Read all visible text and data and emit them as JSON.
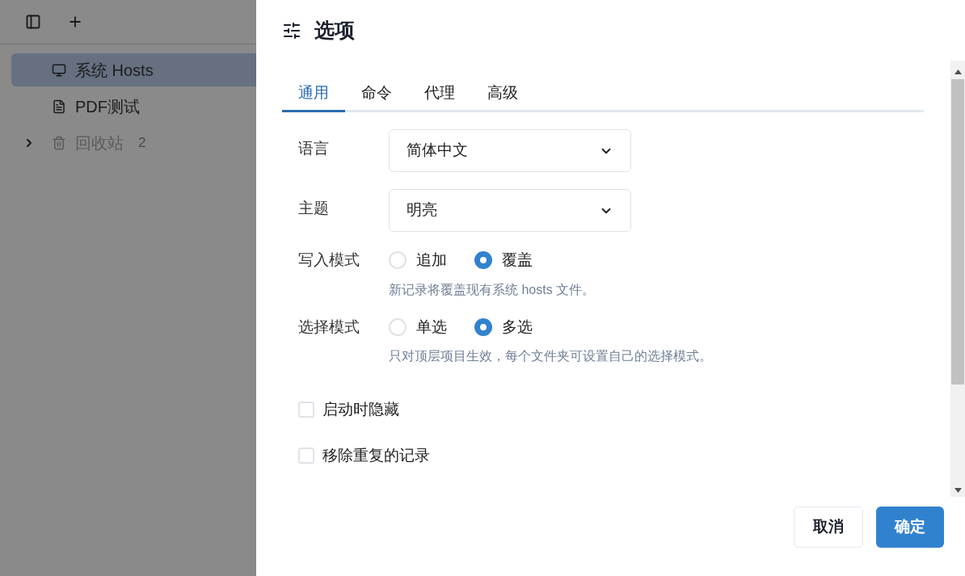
{
  "sidebar": {
    "items": [
      {
        "kind": "monitor",
        "label": "系统 Hosts",
        "selected": true
      },
      {
        "kind": "file",
        "label": "PDF测试",
        "selected": false
      },
      {
        "kind": "trash",
        "label": "回收站",
        "count": "2",
        "expanded": false,
        "selected": false
      }
    ]
  },
  "dialog": {
    "title": "选项",
    "tabs": [
      {
        "label": "通用",
        "selected": true
      },
      {
        "label": "命令",
        "selected": false
      },
      {
        "label": "代理",
        "selected": false
      },
      {
        "label": "高级",
        "selected": false
      }
    ],
    "fields": [
      {
        "kind": "select",
        "label": "语言",
        "value": "简体中文"
      },
      {
        "kind": "select",
        "label": "主题",
        "value": "明亮"
      },
      {
        "kind": "radio",
        "label": "写入模式",
        "options": [
          {
            "label": "追加",
            "selected": false
          },
          {
            "label": "覆盖",
            "selected": true
          }
        ],
        "hint": "新记录将覆盖现有系统 hosts 文件。"
      },
      {
        "kind": "radio",
        "label": "选择模式",
        "options": [
          {
            "label": "单选",
            "selected": false
          },
          {
            "label": "多选",
            "selected": true
          }
        ],
        "hint": "只对顶层项目生效，每个文件夹可设置自己的选择模式。"
      }
    ],
    "checkboxes": [
      {
        "label": "启动时隐藏",
        "checked": false
      },
      {
        "label": "移除重复的记录",
        "checked": false
      }
    ],
    "buttons": [
      {
        "kind": "secondary",
        "label": "取消"
      },
      {
        "kind": "primary",
        "label": "确定"
      }
    ]
  }
}
